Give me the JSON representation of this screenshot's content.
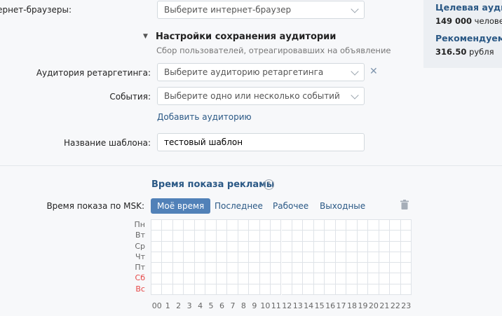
{
  "form": {
    "browsers_label": "Интернет-браузеры:",
    "browsers_placeholder": "Выберите интернет-браузер",
    "save_section_title": "Настройки сохранения аудитории",
    "save_section_sub": "Сбор пользователей, отреагировавших на объявление",
    "retarget_label": "Аудитория ретаргетинга:",
    "retarget_placeholder": "Выберите аудиторию ретаргетинга",
    "events_label": "События:",
    "events_placeholder": "Выберите одно или несколько событий",
    "add_audience": "Добавить аудиторию",
    "template_label": "Название шаблона:",
    "template_value": "тестовый шаблон"
  },
  "sidebar": {
    "target_title": "Целевая аудитория",
    "target_count": "149 000",
    "target_unit": "человек",
    "rec_title": "Рекомендуемая",
    "rec_price": "316.50",
    "rec_unit": "рубля"
  },
  "schedule": {
    "title": "Время показа рекламы",
    "help": "?",
    "label": "Время показа по MSK:",
    "tabs": [
      "Моё время",
      "Последнее",
      "Рабочее",
      "Выходные"
    ],
    "active_tab": 0,
    "days": [
      "Пн",
      "Вт",
      "Ср",
      "Чт",
      "Пт",
      "Сб",
      "Вс"
    ],
    "weekend_days": [
      5,
      6
    ],
    "hours": [
      "00",
      "1",
      "2",
      "3",
      "4",
      "5",
      "6",
      "7",
      "8",
      "9",
      "10",
      "11",
      "12",
      "13",
      "14",
      "15",
      "16",
      "17",
      "18",
      "19",
      "20",
      "21",
      "22",
      "23"
    ]
  },
  "colors": {
    "accent": "#5181b8",
    "link": "#2a5885",
    "weekend": "#e64646"
  }
}
